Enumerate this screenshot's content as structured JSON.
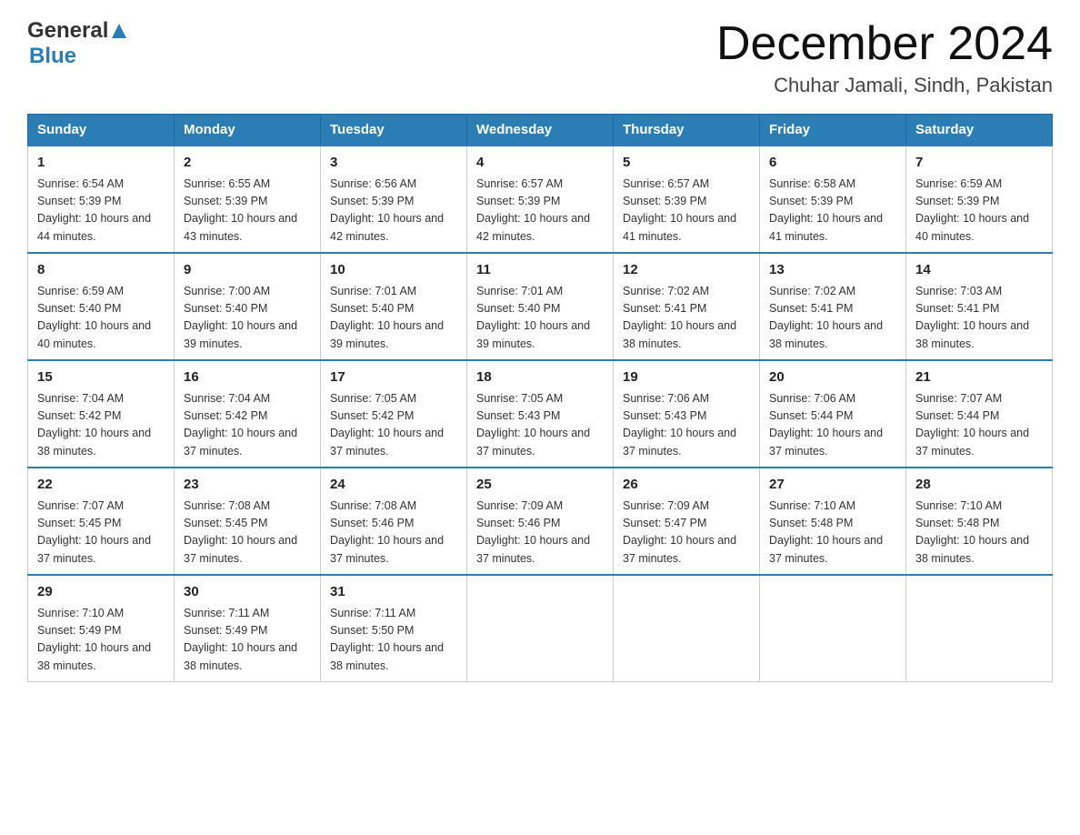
{
  "header": {
    "logo_general": "General",
    "logo_blue": "Blue",
    "month_title": "December 2024",
    "location": "Chuhar Jamali, Sindh, Pakistan"
  },
  "days_of_week": [
    "Sunday",
    "Monday",
    "Tuesday",
    "Wednesday",
    "Thursday",
    "Friday",
    "Saturday"
  ],
  "weeks": [
    [
      {
        "day": "1",
        "sunrise": "6:54 AM",
        "sunset": "5:39 PM",
        "daylight": "10 hours and 44 minutes."
      },
      {
        "day": "2",
        "sunrise": "6:55 AM",
        "sunset": "5:39 PM",
        "daylight": "10 hours and 43 minutes."
      },
      {
        "day": "3",
        "sunrise": "6:56 AM",
        "sunset": "5:39 PM",
        "daylight": "10 hours and 42 minutes."
      },
      {
        "day": "4",
        "sunrise": "6:57 AM",
        "sunset": "5:39 PM",
        "daylight": "10 hours and 42 minutes."
      },
      {
        "day": "5",
        "sunrise": "6:57 AM",
        "sunset": "5:39 PM",
        "daylight": "10 hours and 41 minutes."
      },
      {
        "day": "6",
        "sunrise": "6:58 AM",
        "sunset": "5:39 PM",
        "daylight": "10 hours and 41 minutes."
      },
      {
        "day": "7",
        "sunrise": "6:59 AM",
        "sunset": "5:39 PM",
        "daylight": "10 hours and 40 minutes."
      }
    ],
    [
      {
        "day": "8",
        "sunrise": "6:59 AM",
        "sunset": "5:40 PM",
        "daylight": "10 hours and 40 minutes."
      },
      {
        "day": "9",
        "sunrise": "7:00 AM",
        "sunset": "5:40 PM",
        "daylight": "10 hours and 39 minutes."
      },
      {
        "day": "10",
        "sunrise": "7:01 AM",
        "sunset": "5:40 PM",
        "daylight": "10 hours and 39 minutes."
      },
      {
        "day": "11",
        "sunrise": "7:01 AM",
        "sunset": "5:40 PM",
        "daylight": "10 hours and 39 minutes."
      },
      {
        "day": "12",
        "sunrise": "7:02 AM",
        "sunset": "5:41 PM",
        "daylight": "10 hours and 38 minutes."
      },
      {
        "day": "13",
        "sunrise": "7:02 AM",
        "sunset": "5:41 PM",
        "daylight": "10 hours and 38 minutes."
      },
      {
        "day": "14",
        "sunrise": "7:03 AM",
        "sunset": "5:41 PM",
        "daylight": "10 hours and 38 minutes."
      }
    ],
    [
      {
        "day": "15",
        "sunrise": "7:04 AM",
        "sunset": "5:42 PM",
        "daylight": "10 hours and 38 minutes."
      },
      {
        "day": "16",
        "sunrise": "7:04 AM",
        "sunset": "5:42 PM",
        "daylight": "10 hours and 37 minutes."
      },
      {
        "day": "17",
        "sunrise": "7:05 AM",
        "sunset": "5:42 PM",
        "daylight": "10 hours and 37 minutes."
      },
      {
        "day": "18",
        "sunrise": "7:05 AM",
        "sunset": "5:43 PM",
        "daylight": "10 hours and 37 minutes."
      },
      {
        "day": "19",
        "sunrise": "7:06 AM",
        "sunset": "5:43 PM",
        "daylight": "10 hours and 37 minutes."
      },
      {
        "day": "20",
        "sunrise": "7:06 AM",
        "sunset": "5:44 PM",
        "daylight": "10 hours and 37 minutes."
      },
      {
        "day": "21",
        "sunrise": "7:07 AM",
        "sunset": "5:44 PM",
        "daylight": "10 hours and 37 minutes."
      }
    ],
    [
      {
        "day": "22",
        "sunrise": "7:07 AM",
        "sunset": "5:45 PM",
        "daylight": "10 hours and 37 minutes."
      },
      {
        "day": "23",
        "sunrise": "7:08 AM",
        "sunset": "5:45 PM",
        "daylight": "10 hours and 37 minutes."
      },
      {
        "day": "24",
        "sunrise": "7:08 AM",
        "sunset": "5:46 PM",
        "daylight": "10 hours and 37 minutes."
      },
      {
        "day": "25",
        "sunrise": "7:09 AM",
        "sunset": "5:46 PM",
        "daylight": "10 hours and 37 minutes."
      },
      {
        "day": "26",
        "sunrise": "7:09 AM",
        "sunset": "5:47 PM",
        "daylight": "10 hours and 37 minutes."
      },
      {
        "day": "27",
        "sunrise": "7:10 AM",
        "sunset": "5:48 PM",
        "daylight": "10 hours and 37 minutes."
      },
      {
        "day": "28",
        "sunrise": "7:10 AM",
        "sunset": "5:48 PM",
        "daylight": "10 hours and 38 minutes."
      }
    ],
    [
      {
        "day": "29",
        "sunrise": "7:10 AM",
        "sunset": "5:49 PM",
        "daylight": "10 hours and 38 minutes."
      },
      {
        "day": "30",
        "sunrise": "7:11 AM",
        "sunset": "5:49 PM",
        "daylight": "10 hours and 38 minutes."
      },
      {
        "day": "31",
        "sunrise": "7:11 AM",
        "sunset": "5:50 PM",
        "daylight": "10 hours and 38 minutes."
      },
      null,
      null,
      null,
      null
    ]
  ]
}
